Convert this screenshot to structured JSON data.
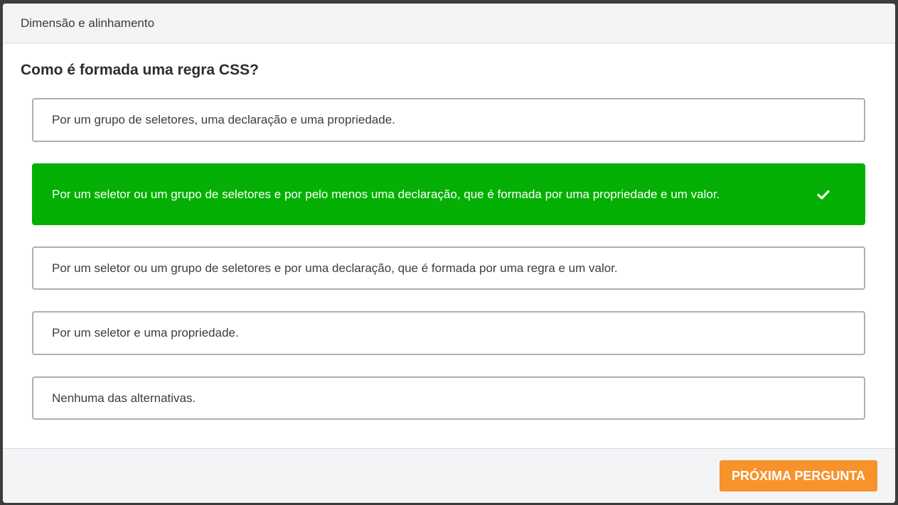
{
  "header": {
    "title": "Dimensão e alinhamento"
  },
  "question": {
    "text": "Como é formada uma regra CSS?"
  },
  "options": [
    {
      "text": "Por um grupo de seletores, uma declaração e uma propriedade.",
      "selected": false
    },
    {
      "text": "Por um seletor ou um grupo de seletores e por pelo menos uma declaração, que é formada por uma propriedade e um valor.",
      "selected": true
    },
    {
      "text": "Por um seletor ou um grupo de seletores e por uma declaração, que é formada por uma regra e um valor.",
      "selected": false
    },
    {
      "text": "Por um seletor e uma propriedade.",
      "selected": false
    },
    {
      "text": "Nenhuma das alternativas.",
      "selected": false
    }
  ],
  "selected_icon": "check-icon",
  "footer": {
    "next_label": "PRÓXIMA PERGUNTA"
  },
  "colors": {
    "selected": "#03b003",
    "accent": "#f7932a",
    "border": "#a9b0b8"
  }
}
